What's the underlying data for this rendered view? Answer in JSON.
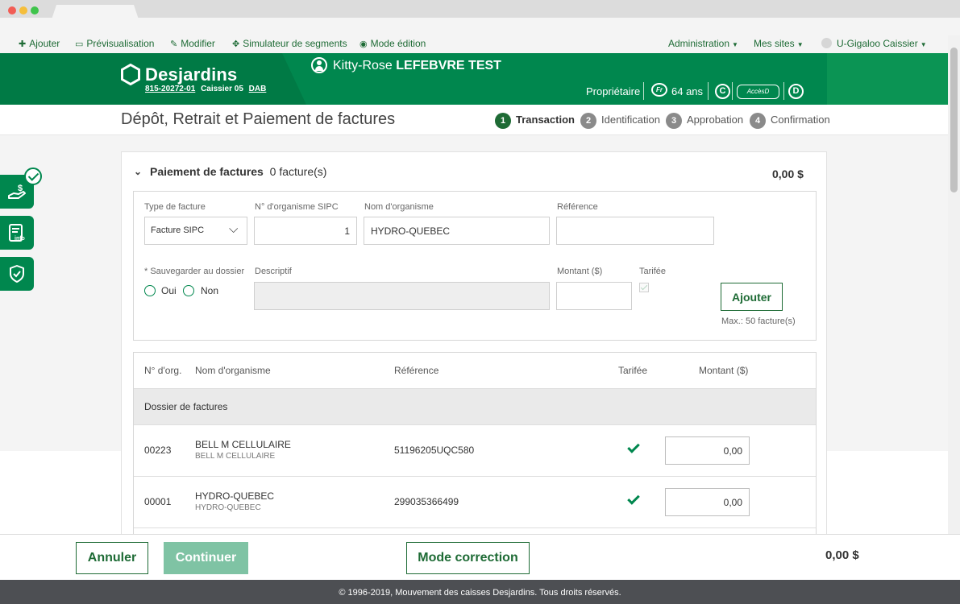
{
  "toolbar": {
    "add": "Ajouter",
    "preview": "Prévisualisation",
    "edit": "Modifier",
    "simulator": "Simulateur de segments",
    "edit_mode": "Mode édition",
    "administration": "Administration",
    "my_sites": "Mes sites",
    "user": "U-Gigaloo Caissier"
  },
  "header": {
    "brand": "Desjardins",
    "branch_code": "815-20272-01",
    "teller": "Caissier 05",
    "dab": "DAB",
    "client_first": "Kitty-Rose",
    "client_last": "LEFEBVRE TEST",
    "role": "Propriétaire",
    "lang": "Fr",
    "age": "64 ans",
    "c_label": "C",
    "acces": "AccèsD",
    "d_label": "D",
    "brand_color": "#00874e"
  },
  "page": {
    "title": "Dépôt, Retrait et Paiement de factures",
    "steps": [
      {
        "num": "1",
        "label": "Transaction"
      },
      {
        "num": "2",
        "label": "Identification"
      },
      {
        "num": "3",
        "label": "Approbation"
      },
      {
        "num": "4",
        "label": "Confirmation"
      }
    ]
  },
  "section": {
    "title": "Paiement de factures",
    "count": "0",
    "count_label": "facture(s)",
    "total": "0,00 $"
  },
  "form": {
    "type_label": "Type de facture",
    "type_value": "Facture SIPC",
    "org_no_label": "N° d'organisme SIPC",
    "org_no_value": "1",
    "org_name_label": "Nom d'organisme",
    "org_name_value": "HYDRO-QUEBEC",
    "reference_label": "Référence",
    "reference_value": "",
    "save_label": "* Sauvegarder au dossier",
    "yes": "Oui",
    "no": "Non",
    "desc_label": "Descriptif",
    "amount_label": "Montant ($)",
    "tarifee_label": "Tarifée",
    "add_button": "Ajouter",
    "max_note": "Max.: 50 facture(s)"
  },
  "table": {
    "headers": [
      "N° d'org.",
      "Nom d'organisme",
      "Référence",
      "Tarifée",
      "Montant ($)"
    ],
    "group": "Dossier de factures",
    "rows": [
      {
        "org_no": "00223",
        "name": "BELL M CELLULAIRE",
        "sub": "BELL M CELLULAIRE",
        "reference": "51196205UQC580",
        "tarifee": true,
        "amount": "0,00"
      },
      {
        "org_no": "00001",
        "name": "HYDRO-QUEBEC",
        "sub": "HYDRO-QUEBEC",
        "reference": "299035366499",
        "tarifee": true,
        "amount": "0,00"
      }
    ]
  },
  "footer": {
    "cancel": "Annuler",
    "continue": "Continuer",
    "correction": "Mode correction",
    "total": "0,00 $",
    "copyright": "© 1996-2019, Mouvement des caisses Desjardins. Tous droits réservés."
  }
}
